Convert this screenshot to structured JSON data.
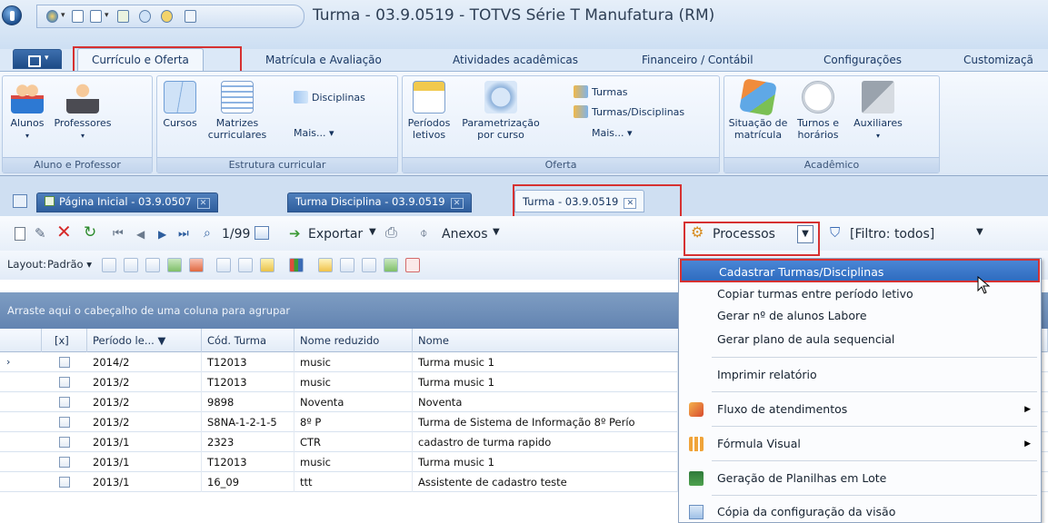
{
  "window": {
    "title": "Turma - 03.9.0519 - TOTVS Série T Manufatura (RM)"
  },
  "ribbon_tabs": [
    "Currículo e Oferta",
    "Matrícula e Avaliação",
    "Atividades acadêmicas",
    "Financeiro / Contábil",
    "Configurações",
    "Customizaçã"
  ],
  "ribbon": {
    "aluno_professor": {
      "label": "Aluno e Professor",
      "alunos": "Alunos",
      "professores": "Professores"
    },
    "estrutura": {
      "label": "Estrutura curricular",
      "cursos": "Cursos",
      "matrizes_1": "Matrizes",
      "matrizes_2": "curriculares",
      "disciplinas": "Disciplinas",
      "mais": "Mais... ▾"
    },
    "oferta": {
      "label": "Oferta",
      "periodos_1": "Períodos",
      "periodos_2": "letivos",
      "param_1": "Parametrização",
      "param_2": "por curso",
      "turmas": "Turmas",
      "turmas_disc": "Turmas/Disciplinas",
      "mais": "Mais... ▾"
    },
    "academico": {
      "label": "Acadêmico",
      "situacao_1": "Situação de",
      "situacao_2": "matrícula",
      "turnos_1": "Turnos e",
      "turnos_2": "horários",
      "auxiliares": "Auxiliares"
    }
  },
  "doc_tabs": [
    {
      "label": "Página Inicial - 03.9.0507"
    },
    {
      "label": "Turma Disciplina - 03.9.0519"
    },
    {
      "label": "Turma - 03.9.0519"
    }
  ],
  "toolbar": {
    "record_count": "1/99",
    "exportar": "Exportar",
    "anexos": "Anexos",
    "processos": "Processos",
    "filtro": "[Filtro: todos]"
  },
  "layout_bar": {
    "label": "Layout:",
    "preset": "Padrão ▾"
  },
  "grid": {
    "group_hint": "Arraste aqui o cabeçalho de uma coluna para agrupar",
    "columns": [
      "[x]",
      "Período le... ▼",
      "Cód. Turma",
      "Nome reduzido",
      "Nome"
    ],
    "rows": [
      [
        "2014/2",
        "T12013",
        "music",
        "Turma music 1"
      ],
      [
        "2013/2",
        "T12013",
        "music",
        "Turma music 1"
      ],
      [
        "2013/2",
        "9898",
        "Noventa",
        "Noventa"
      ],
      [
        "2013/2",
        "S8NA-1-2-1-5",
        "8º P",
        "Turma de Sistema de Informação 8º Perío"
      ],
      [
        "2013/1",
        "2323",
        "CTR",
        "cadastro de turma rapido"
      ],
      [
        "2013/1",
        "T12013",
        "music",
        "Turma music 1"
      ],
      [
        "2013/1",
        "16_09",
        "ttt",
        "Assistente de cadastro teste"
      ]
    ]
  },
  "processos_menu": [
    "Cadastrar Turmas/Disciplinas",
    "Copiar turmas entre período letivo",
    "Gerar nº de alunos Labore",
    "Gerar plano de aula sequencial",
    "Imprimir relatório",
    "Fluxo de atendimentos",
    "Fórmula Visual",
    "Geração de Planilhas em Lote",
    "Cópia da configuração da visão"
  ]
}
